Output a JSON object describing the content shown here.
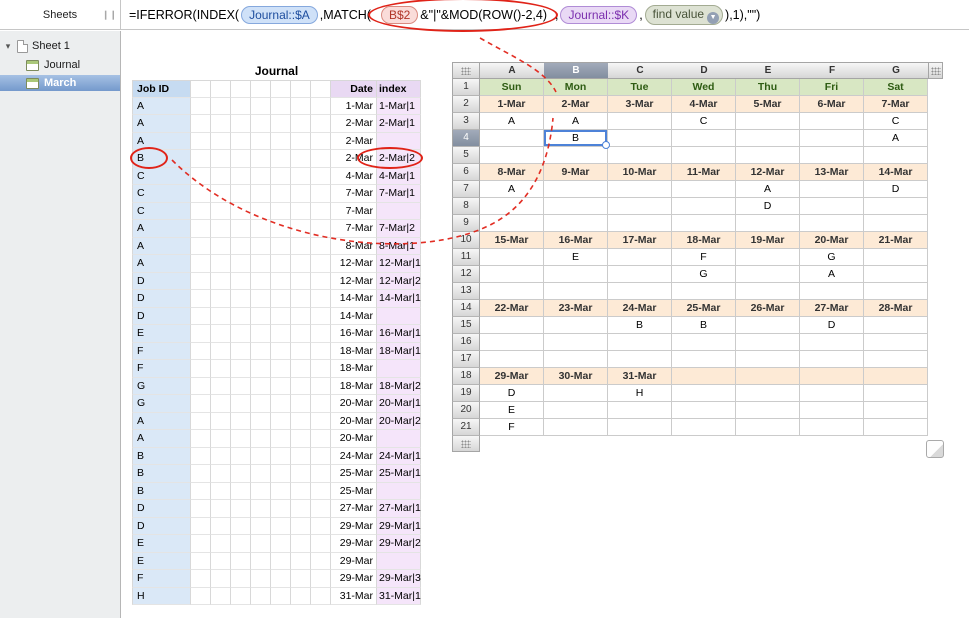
{
  "sidebar": {
    "title": "Sheets",
    "sheet_label": "Sheet 1",
    "journal_label": "Journal",
    "march_label": "March"
  },
  "formula": {
    "prefix": "=IFERROR(INDEX(",
    "ref_a": "Journal::$A",
    "match": ",MATCH(",
    "ref_b2": "B$2",
    "mod_expr": "&\"|\"&MOD(ROW()-2,4)",
    "comma1": ",",
    "ref_k": "Journal::$K",
    "comma2": ",",
    "find_value": "find value",
    "suffix": "),1),\"\")"
  },
  "journal": {
    "title": "Journal",
    "col_job": "Job ID",
    "col_date": "Date",
    "col_index": "index",
    "circled_row": 3,
    "rows": [
      [
        "A",
        "1-Mar",
        "1-Mar|1"
      ],
      [
        "A",
        "2-Mar",
        "2-Mar|1"
      ],
      [
        "A",
        "2-Mar",
        ""
      ],
      [
        "B",
        "2-Mar",
        "2-Mar|2"
      ],
      [
        "C",
        "4-Mar",
        "4-Mar|1"
      ],
      [
        "C",
        "7-Mar",
        "7-Mar|1"
      ],
      [
        "C",
        "7-Mar",
        ""
      ],
      [
        "A",
        "7-Mar",
        "7-Mar|2"
      ],
      [
        "A",
        "8-Mar",
        "8-Mar|1"
      ],
      [
        "A",
        "12-Mar",
        "12-Mar|1"
      ],
      [
        "D",
        "12-Mar",
        "12-Mar|2"
      ],
      [
        "D",
        "14-Mar",
        "14-Mar|1"
      ],
      [
        "D",
        "14-Mar",
        ""
      ],
      [
        "E",
        "16-Mar",
        "16-Mar|1"
      ],
      [
        "F",
        "18-Mar",
        "18-Mar|1"
      ],
      [
        "F",
        "18-Mar",
        ""
      ],
      [
        "G",
        "18-Mar",
        "18-Mar|2"
      ],
      [
        "G",
        "20-Mar",
        "20-Mar|1"
      ],
      [
        "A",
        "20-Mar",
        "20-Mar|2"
      ],
      [
        "A",
        "20-Mar",
        ""
      ],
      [
        "B",
        "24-Mar",
        "24-Mar|1"
      ],
      [
        "B",
        "25-Mar",
        "25-Mar|1"
      ],
      [
        "B",
        "25-Mar",
        ""
      ],
      [
        "D",
        "27-Mar",
        "27-Mar|1"
      ],
      [
        "D",
        "29-Mar",
        "29-Mar|1"
      ],
      [
        "E",
        "29-Mar",
        "29-Mar|2"
      ],
      [
        "E",
        "29-Mar",
        ""
      ],
      [
        "F",
        "29-Mar",
        "29-Mar|3"
      ],
      [
        "H",
        "31-Mar",
        "31-Mar|1"
      ]
    ]
  },
  "calendar": {
    "columns": [
      "A",
      "B",
      "C",
      "D",
      "E",
      "F",
      "G"
    ],
    "selected": {
      "col": "B",
      "row": 4,
      "value": "B"
    },
    "rows": [
      {
        "n": 1,
        "band": "weekday",
        "cells": [
          "Sun",
          "Mon",
          "Tue",
          "Wed",
          "Thu",
          "Fri",
          "Sat"
        ]
      },
      {
        "n": 2,
        "band": "dates",
        "cells": [
          "1-Mar",
          "2-Mar",
          "3-Mar",
          "4-Mar",
          "5-Mar",
          "6-Mar",
          "7-Mar"
        ]
      },
      {
        "n": 3,
        "band": "data",
        "cells": [
          "A",
          "A",
          "",
          "C",
          "",
          "",
          "C"
        ]
      },
      {
        "n": 4,
        "band": "data",
        "cells": [
          "",
          "B",
          "",
          "",
          "",
          "",
          "A"
        ]
      },
      {
        "n": 5,
        "band": "data",
        "cells": [
          "",
          "",
          "",
          "",
          "",
          "",
          ""
        ]
      },
      {
        "n": 6,
        "band": "dates",
        "cells": [
          "8-Mar",
          "9-Mar",
          "10-Mar",
          "11-Mar",
          "12-Mar",
          "13-Mar",
          "14-Mar"
        ]
      },
      {
        "n": 7,
        "band": "data",
        "cells": [
          "A",
          "",
          "",
          "",
          "A",
          "",
          "D"
        ]
      },
      {
        "n": 8,
        "band": "data",
        "cells": [
          "",
          "",
          "",
          "",
          "D",
          "",
          ""
        ]
      },
      {
        "n": 9,
        "band": "data",
        "cells": [
          "",
          "",
          "",
          "",
          "",
          "",
          ""
        ]
      },
      {
        "n": 10,
        "band": "dates",
        "cells": [
          "15-Mar",
          "16-Mar",
          "17-Mar",
          "18-Mar",
          "19-Mar",
          "20-Mar",
          "21-Mar"
        ]
      },
      {
        "n": 11,
        "band": "data",
        "cells": [
          "",
          "E",
          "",
          "F",
          "",
          "G",
          ""
        ]
      },
      {
        "n": 12,
        "band": "data",
        "cells": [
          "",
          "",
          "",
          "G",
          "",
          "A",
          ""
        ]
      },
      {
        "n": 13,
        "band": "data",
        "cells": [
          "",
          "",
          "",
          "",
          "",
          "",
          ""
        ]
      },
      {
        "n": 14,
        "band": "dates",
        "cells": [
          "22-Mar",
          "23-Mar",
          "24-Mar",
          "25-Mar",
          "26-Mar",
          "27-Mar",
          "28-Mar"
        ]
      },
      {
        "n": 15,
        "band": "data",
        "cells": [
          "",
          "",
          "B",
          "B",
          "",
          "D",
          ""
        ]
      },
      {
        "n": 16,
        "band": "data",
        "cells": [
          "",
          "",
          "",
          "",
          "",
          "",
          ""
        ]
      },
      {
        "n": 17,
        "band": "data",
        "cells": [
          "",
          "",
          "",
          "",
          "",
          "",
          ""
        ]
      },
      {
        "n": 18,
        "band": "dates",
        "cells": [
          "29-Mar",
          "30-Mar",
          "31-Mar",
          "",
          "",
          "",
          ""
        ]
      },
      {
        "n": 19,
        "band": "data",
        "cells": [
          "D",
          "",
          "H",
          "",
          "",
          "",
          ""
        ]
      },
      {
        "n": 20,
        "band": "data",
        "cells": [
          "E",
          "",
          "",
          "",
          "",
          "",
          ""
        ]
      },
      {
        "n": 21,
        "band": "data",
        "cells": [
          "F",
          "",
          "",
          "",
          "",
          "",
          ""
        ]
      }
    ]
  },
  "colors": {
    "selection_blue": "#4d82d8",
    "annotation_red": "#e02318",
    "weekday_band_green": "#d8e7c3",
    "date_band_peach": "#fdead6",
    "job_column_blue": "#dae8f7",
    "index_column_purple": "#f5e5fa"
  }
}
